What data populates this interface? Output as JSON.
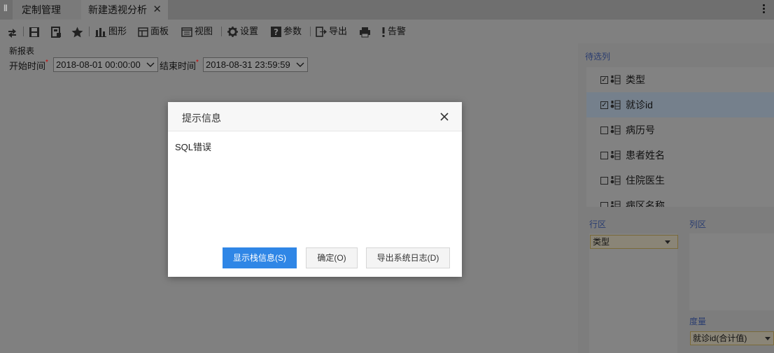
{
  "tabs": [
    {
      "label": "定制管理"
    },
    {
      "label": "新建透视分析",
      "close": "✕"
    }
  ],
  "toolbar": {
    "chart_label": "图形",
    "panel_label": "面板",
    "view_label": "视图",
    "settings_label": "设置",
    "params_label": "参数",
    "export_label": "导出",
    "alert_label": "告警"
  },
  "report": {
    "title": "新报表",
    "start_label": "开始时间",
    "start_value": "2018-08-01 00:00:00",
    "end_label": "结束时间",
    "end_value": "2018-08-31 23:59:59",
    "required_mark": "*"
  },
  "right_panel": {
    "candidates_label": "待选列",
    "fields": [
      {
        "label": "类型",
        "checked": true
      },
      {
        "label": "就诊id",
        "checked": true
      },
      {
        "label": "病历号",
        "checked": false
      },
      {
        "label": "患者姓名",
        "checked": false
      },
      {
        "label": "住院医生",
        "checked": false
      },
      {
        "label": "病区名称",
        "checked": false
      }
    ],
    "row_zone_label": "行区",
    "col_zone_label": "列区",
    "measure_label": "度量",
    "row_item": "类型",
    "measure_item": "就诊id(合计值)"
  },
  "dialog": {
    "title": "提示信息",
    "message": "SQL错误",
    "btn_stack": "显示栈信息(S)",
    "btn_ok": "确定(O)",
    "btn_export_log": "导出系统日志(D)"
  },
  "colors": {
    "primary_button": "#2f86e6",
    "overlay": "#808080",
    "zone_label": "#2a3d70"
  }
}
